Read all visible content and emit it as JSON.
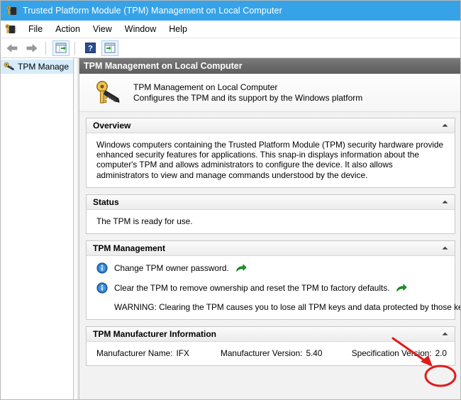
{
  "window": {
    "title": "Trusted Platform Module (TPM) Management on Local Computer",
    "icon": "tpm-chip-key-icon"
  },
  "menubar": {
    "icon": "tpm-chip-key-icon",
    "items": [
      {
        "label": "File"
      },
      {
        "label": "Action"
      },
      {
        "label": "View"
      },
      {
        "label": "Window"
      },
      {
        "label": "Help"
      }
    ]
  },
  "toolbar": {
    "buttons": [
      {
        "name": "back-button",
        "icon": "left-arrow-icon"
      },
      {
        "name": "forward-button",
        "icon": "right-arrow-icon"
      },
      {
        "name": "show-hide-console-tree-button",
        "icon": "console-tree-icon"
      },
      {
        "name": "help-button",
        "icon": "question-mark-icon"
      },
      {
        "name": "show-hide-action-pane-button",
        "icon": "action-pane-icon"
      }
    ]
  },
  "sidebar": {
    "items": [
      {
        "label": "TPM Manage",
        "icon": "tpm-key-icon",
        "selected": true
      }
    ]
  },
  "pane": {
    "header_title": "TPM Management on Local Computer",
    "banner": {
      "icon": "tpm-key-chip-icon",
      "title": "TPM Management on Local Computer",
      "subtitle": "Configures the TPM and its support by the Windows platform"
    },
    "sections": [
      {
        "id": "overview",
        "title": "Overview",
        "collapse_icon": "chevron-up-icon",
        "body": "Windows computers containing the Trusted Platform Module (TPM) security hardware provide enhanced security features for applications. This snap-in displays information about the computer's TPM and allows administrators to configure the device. It also allows administrators to view and manage commands understood by the device."
      },
      {
        "id": "status",
        "title": "Status",
        "collapse_icon": "chevron-up-icon",
        "body": "The TPM is ready for use."
      },
      {
        "id": "tpm-management",
        "title": "TPM Management",
        "collapse_icon": "chevron-up-icon",
        "actions": [
          {
            "text": "Change TPM owner password.",
            "info_icon": "info-icon",
            "shortcut_icon": "green-shortcut-arrow-icon"
          },
          {
            "text": "Clear the TPM to remove ownership and reset the TPM to factory defaults.",
            "info_icon": "info-icon",
            "shortcut_icon": "green-shortcut-arrow-icon"
          }
        ],
        "warning": "WARNING: Clearing the TPM causes you to lose all TPM keys and data protected by those keys."
      },
      {
        "id": "tpm-manufacturer-information",
        "title": "TPM Manufacturer Information",
        "collapse_icon": "chevron-up-icon",
        "fields": [
          {
            "label": "Manufacturer Name:",
            "value": "IFX"
          },
          {
            "label": "Manufacturer Version:",
            "value": "5.40"
          },
          {
            "label": "Specification Version:",
            "value": "2.0"
          }
        ]
      }
    ]
  },
  "annotation": {
    "color": "#e01b1b",
    "arrow": "red-arrow-pointing-to-specification-version",
    "ellipse": "red-ellipse-around-specification-version-value"
  },
  "colors": {
    "titlebar": "#36a3e8",
    "pane_header": "#6a6a6a",
    "selection": "#d6ecfb",
    "annotation": "#e01b1b",
    "info_icon": "#1f6fc4",
    "shortcut_icon": "#00a000"
  }
}
